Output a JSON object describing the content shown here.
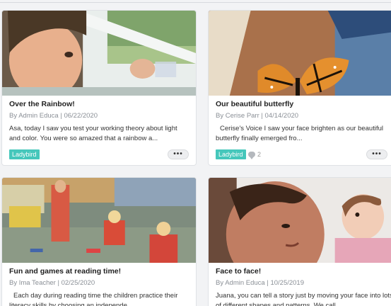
{
  "posts": [
    {
      "title": "Over the Rainbow!",
      "meta": "By Admin Educa | 06/22/2020",
      "excerpt": "Asa, today I saw you test your working theory about light and color. You were so amazed that a rainbow a...",
      "tag": "Ladybird",
      "more_label": "•••"
    },
    {
      "title": "Our beautiful butterfly",
      "meta": "By Cerise Parr | 04/14/2020",
      "excerpt": "Cerise's Voice I saw your face brighten as our beautiful butterfly finally emerged fro...",
      "tag": "Ladybird",
      "comment_count": "2",
      "more_label": "•••"
    },
    {
      "title": "Fun and games at reading time!",
      "meta": "By Ima Teacher | 02/25/2020",
      "excerpt": "Each day during reading time the children practice their literacy skills by choosing an independe..."
    },
    {
      "title": "Face to face!",
      "meta": "By Admin Educa | 10/25/2019",
      "excerpt": "Juana, you can tell a story just by moving your face into lots of different shapes and patterns. We call..."
    }
  ],
  "colors": {
    "tag": "#45c7bb",
    "background": "#f2f3f5"
  }
}
